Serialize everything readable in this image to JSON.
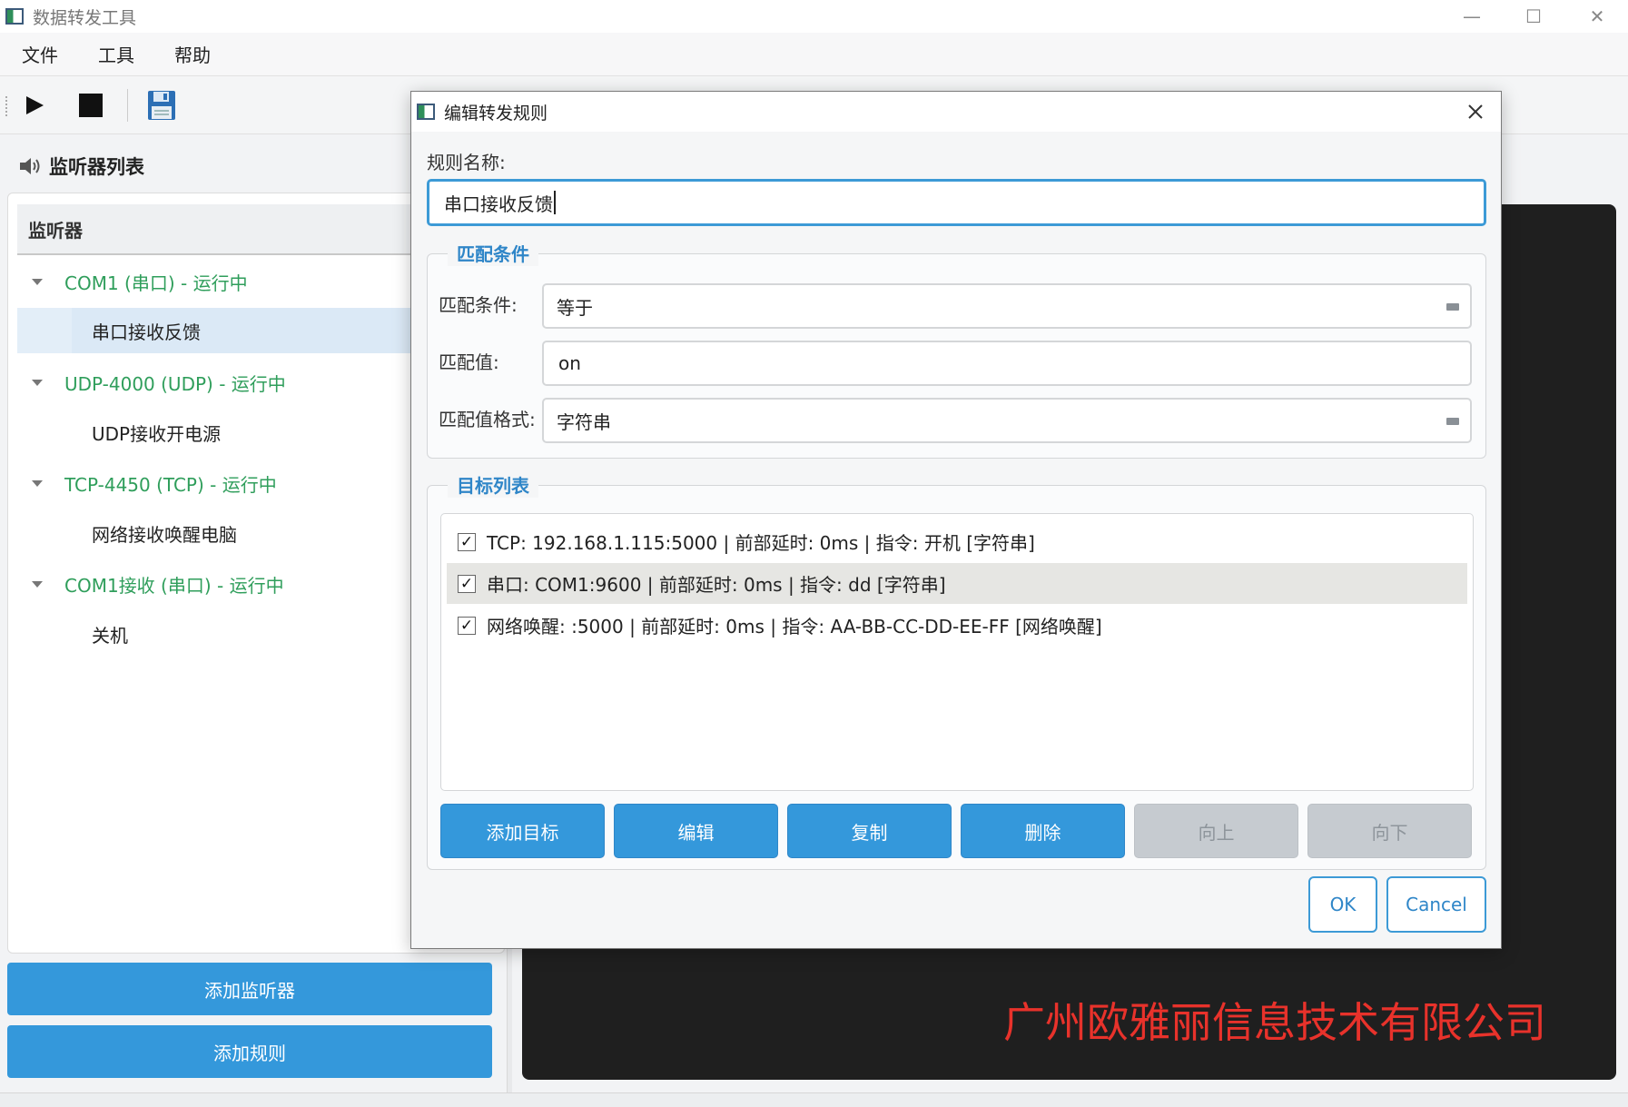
{
  "window": {
    "title": "数据转发工具",
    "minimize": "—",
    "maximize": "☐",
    "close": "✕"
  },
  "menu": [
    "文件",
    "工具",
    "帮助"
  ],
  "toolbar": {
    "start_icon": "play-icon",
    "stop_icon": "stop-icon",
    "save_icon": "floppy-disk-icon"
  },
  "left_panel": {
    "title": "监听器列表",
    "title_icon": "speaker-icon",
    "tree_header": "监听器",
    "tree": [
      {
        "label": "COM1 (串口) - 运行中",
        "children": [
          "串口接收反馈"
        ]
      },
      {
        "label": "UDP-4000 (UDP) - 运行中",
        "children": [
          "UDP接收开电源"
        ]
      },
      {
        "label": "TCP-4450 (TCP) - 运行中",
        "children": [
          "网络接收唤醒电脑"
        ]
      },
      {
        "label": "COM1接收 (串口) - 运行中",
        "children": [
          "关机"
        ]
      }
    ],
    "add_listener": "添加监听器",
    "add_rule": "添加规则"
  },
  "company": "广州欧雅丽信息技术有限公司",
  "dialog": {
    "title": "编辑转发规则",
    "rule_name_label": "规则名称:",
    "rule_name_value": "串口接收反馈",
    "match_group_title": "匹配条件",
    "match_condition_label": "匹配条件:",
    "match_condition_value": "等于",
    "match_value_label": "匹配值:",
    "match_value_value": "on",
    "match_format_label": "匹配值格式:",
    "match_format_value": "字符串",
    "target_group_title": "目标列表",
    "targets": [
      {
        "checked": "✓",
        "text": "TCP: 192.168.1.115:5000 | 前部延时: 0ms | 指令: 开机 [字符串]"
      },
      {
        "checked": "✓",
        "text": "串口: COM1:9600 | 前部延时: 0ms | 指令: dd [字符串]"
      },
      {
        "checked": "✓",
        "text": "网络唤醒: :5000 | 前部延时: 0ms | 指令: AA-BB-CC-DD-EE-FF [网络唤醒]"
      }
    ],
    "buttons": {
      "add": "添加目标",
      "edit": "编辑",
      "copy": "复制",
      "delete": "删除",
      "up": "向上",
      "down": "向下"
    },
    "ok": "OK",
    "cancel": "Cancel"
  },
  "colors": {
    "accent": "#3498db",
    "running_green": "#2f9e5b",
    "company_red": "#e8322b",
    "dark_bg": "#1f1f1f"
  }
}
